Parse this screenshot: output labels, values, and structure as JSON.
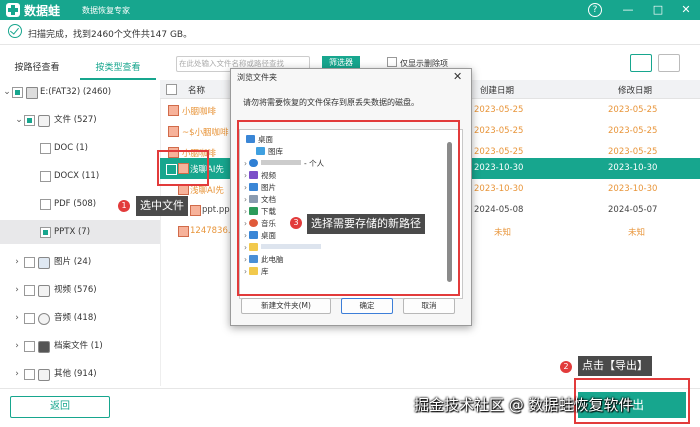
{
  "app": {
    "brand": "数据蛙",
    "subtitle": "数据恢复专家"
  },
  "colors": {
    "accent": "#17a68e",
    "annotation": "#e23b3b",
    "orange_text": "#e8953a"
  },
  "window_controls": [
    "?",
    "—",
    "□",
    "✕"
  ],
  "status": {
    "text": "扫描完成，找到2460个文件共147 GB。"
  },
  "tabs": {
    "path": "按路径查看",
    "type": "按类型查看"
  },
  "tree": [
    {
      "label": "E:(FAT32) (2460)"
    },
    {
      "label": "文件 (527)"
    },
    {
      "label": "DOC (1)"
    },
    {
      "label": "DOCX (11)"
    },
    {
      "label": "PDF (508)"
    },
    {
      "label": "PPTX (7)"
    },
    {
      "label": "图片 (24)"
    },
    {
      "label": "视频 (576)"
    },
    {
      "label": "音频 (418)"
    },
    {
      "label": "档案文件 (1)"
    },
    {
      "label": "其他 (914)"
    }
  ],
  "toolbar": {
    "search_placeholder": "在此处输入文件名称或路径查找",
    "filter": "筛选器",
    "show_deleted": "仅显示删除项"
  },
  "table": {
    "headers": {
      "name": "名称",
      "created": "创建日期",
      "modified": "修改日期"
    },
    "rows": [
      {
        "name": "小胭咖啡",
        "created": "2023-05-25",
        "modified": "2023-05-25"
      },
      {
        "name": "~$小胭咖啡",
        "created": "2023-05-25",
        "modified": "2023-05-25"
      },
      {
        "name": "小胭咖啡",
        "created": "2023-05-25",
        "modified": "2023-05-25"
      },
      {
        "name": "浅聊AI先",
        "created": "2023-10-30",
        "modified": "2023-10-30"
      },
      {
        "name": "浅聊AI先",
        "created": "2023-10-30",
        "modified": "2023-10-30"
      },
      {
        "name": "ppt.pp",
        "created": "2024-05-08",
        "modified": "2024-05-07"
      },
      {
        "name": "1247836.p",
        "created": "未知",
        "modified": "未知"
      }
    ]
  },
  "dialog": {
    "title": "浏览文件夹",
    "message": "请勿将需要恢复的文件保存到原丢失数据的磁盘。",
    "nodes": [
      "桌面",
      "图库",
      "- 个人",
      "视频",
      "图片",
      "文档",
      "下载",
      "音乐",
      "桌面",
      "此电脑",
      "库"
    ],
    "new_folder": "新建文件夹(M)",
    "ok": "确定",
    "cancel": "取消"
  },
  "annotations": {
    "a1": {
      "num": "1",
      "text": "选中文件"
    },
    "a2": {
      "num": "2",
      "text": "点击【导出】"
    },
    "a3": {
      "num": "3",
      "text": "选择需要存储的新路径"
    }
  },
  "footer": {
    "back": "返回",
    "export": "导出"
  },
  "watermark": "掘金技术社区 @ 数据蛙恢复软件"
}
